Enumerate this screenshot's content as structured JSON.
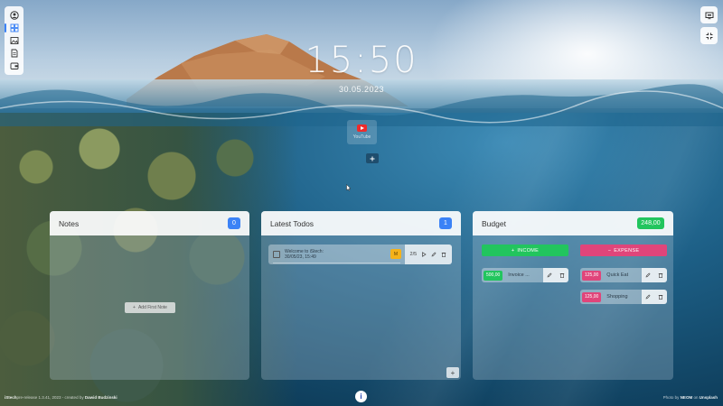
{
  "clock": {
    "time": "15:50",
    "date": "30.05.2023"
  },
  "sidebar": {
    "items": [
      {
        "icon": "user-circle-icon"
      },
      {
        "icon": "dashboard-icon",
        "active": true
      },
      {
        "icon": "image-icon"
      },
      {
        "icon": "document-icon"
      },
      {
        "icon": "wallet-icon"
      }
    ]
  },
  "top_right": {
    "buttons": [
      "screen-icon",
      "fullscreen-icon"
    ]
  },
  "shortcuts": [
    {
      "label": "YouTube",
      "icon": "youtube-icon"
    }
  ],
  "notes": {
    "title": "Notes",
    "count": "0",
    "add_label": "Add First Note"
  },
  "todos": {
    "title": "Latest Todos",
    "count": "1",
    "items": [
      {
        "text_line1": "Welcome to iStech:",
        "text_line2": "30/05/23, 15:49",
        "priority": "M",
        "count": "2/5"
      }
    ]
  },
  "budget": {
    "title": "Budget",
    "total": "248,00",
    "income_label": "INCOME",
    "expense_label": "EXPENSE",
    "income": [
      {
        "amount": "500,00",
        "name": "Invoice ..."
      }
    ],
    "expenses": [
      {
        "amount": "125,00",
        "name": "Quick Eat"
      },
      {
        "amount": "125,00",
        "name": "Shopping"
      }
    ]
  },
  "footer": {
    "app": "iStech",
    "version": "pre-release 1.3.41",
    "year_text": ", 2023 - created by",
    "author": "Dawid Budzinski",
    "photo_prefix": "Photo by",
    "photographer": "NEOM",
    "photo_site_prefix": "on",
    "photo_site": "Unsplash"
  },
  "colors": {
    "accent": "#3b82f6",
    "income": "#22c55e",
    "expense": "#e0457a",
    "priority": "#f5b21b"
  }
}
